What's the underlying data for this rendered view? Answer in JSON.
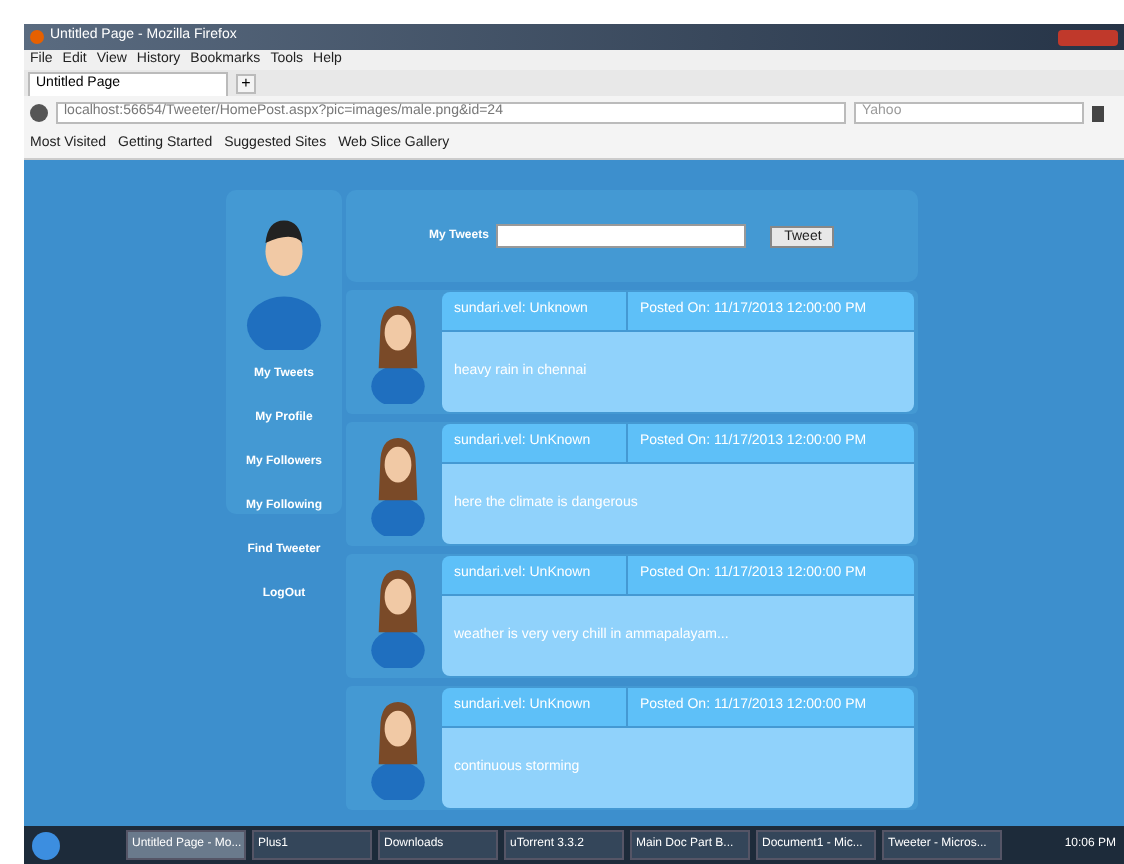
{
  "window": {
    "title": "Untitled Page - Mozilla Firefox"
  },
  "menu": [
    "File",
    "Edit",
    "View",
    "History",
    "Bookmarks",
    "Tools",
    "Help"
  ],
  "tabs": [
    {
      "label": "Untitled Page",
      "selected": true
    }
  ],
  "new_tab": "+",
  "address": "localhost:56654/Tweeter/HomePost.aspx?pic=images/male.png&id=24",
  "search": {
    "placeholder": "Yahoo"
  },
  "bookmarks": [
    "Most Visited",
    "Getting Started",
    "Suggested Sites",
    "Web Slice Gallery"
  ],
  "sidebar": {
    "items": [
      "My Tweets",
      "My Profile",
      "My Followers",
      "My Following",
      "Find Tweeter",
      "LogOut"
    ]
  },
  "compose": {
    "label": "My Tweets",
    "button": "Tweet"
  },
  "posts": [
    {
      "author": "sundari.vel: Unknown",
      "date": "Posted On: 11/17/2013 12:00:00 PM",
      "text": "heavy rain in chennai"
    },
    {
      "author": "sundari.vel: UnKnown",
      "date": "Posted On: 11/17/2013 12:00:00 PM",
      "text": "here the climate is dangerous"
    },
    {
      "author": "sundari.vel: UnKnown",
      "date": "Posted On: 11/17/2013 12:00:00 PM",
      "text": "weather is very very chill in ammapalayam..."
    },
    {
      "author": "sundari.vel: UnKnown",
      "date": "Posted On: 11/17/2013 12:00:00 PM",
      "text": "continuous storming"
    }
  ],
  "taskbar": {
    "items": [
      {
        "label": "Untitled Page - Mo...",
        "selected": true
      },
      {
        "label": "Plus1",
        "selected": false
      },
      {
        "label": "Downloads",
        "selected": false
      },
      {
        "label": "uTorrent 3.3.2",
        "selected": false
      },
      {
        "label": "Main Doc Part B...",
        "selected": false
      },
      {
        "label": "Document1 - Mic...",
        "selected": false
      },
      {
        "label": "Tweeter - Micros...",
        "selected": false
      }
    ],
    "clock": "10:06 PM"
  }
}
